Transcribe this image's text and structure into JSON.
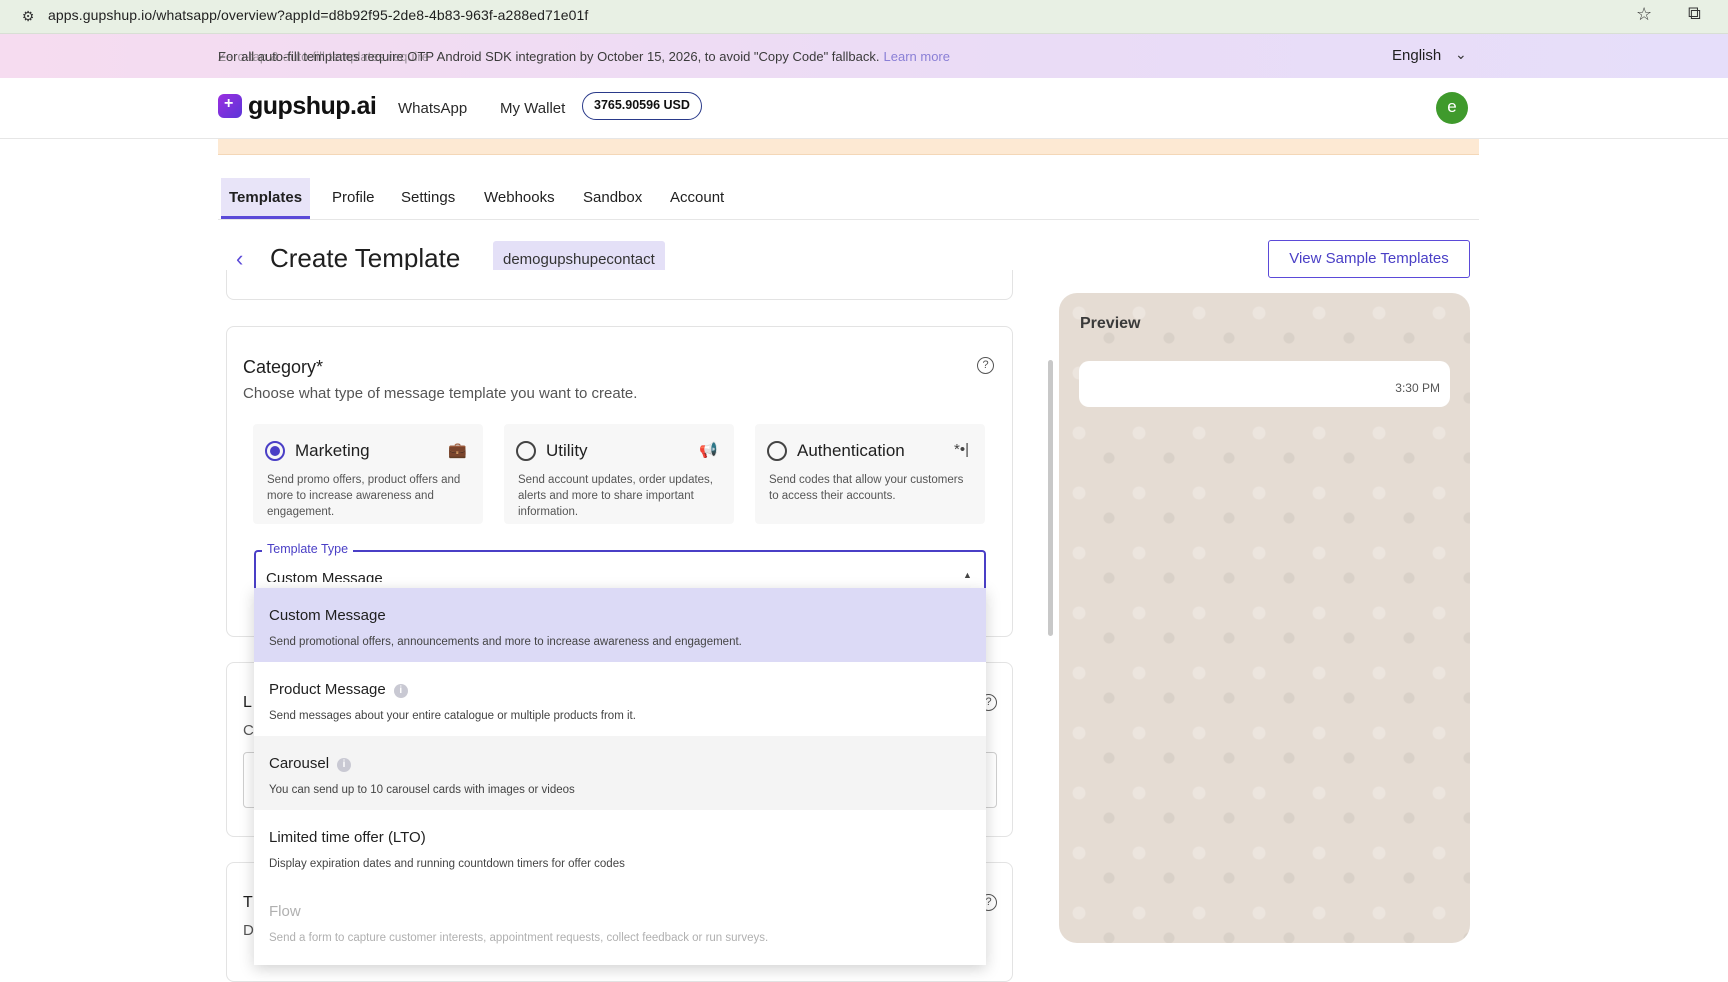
{
  "browser": {
    "url": "apps.gupshup.io/whatsapp/overview?appId=d8b92f95-2de8-4b83-963f-a288ed71e01f"
  },
  "banner": {
    "text": "For all auto-fill templates require OTP Android SDK integration by October 15, 2026, to avoid \"Copy Code\" fallback.",
    "overlay_text": "Zero-tap & auto-fill templates require",
    "learn_more": "Learn more",
    "language": "English"
  },
  "header": {
    "logo": "gupshup.ai",
    "nav_whatsapp": "WhatsApp",
    "nav_wallet": "My Wallet",
    "wallet_balance": "3765.90596 USD",
    "avatar_initial": "e"
  },
  "tabs": [
    {
      "label": "Templates",
      "active": true
    },
    {
      "label": "Profile"
    },
    {
      "label": "Settings"
    },
    {
      "label": "Webhooks"
    },
    {
      "label": "Sandbox"
    },
    {
      "label": "Account"
    }
  ],
  "title_row": {
    "title": "Create Template",
    "app_name": "demogupshupecontact",
    "sample_button": "View Sample Templates"
  },
  "category": {
    "title": "Category*",
    "subtitle": "Choose what type of message template you want to create.",
    "options": [
      {
        "label": "Marketing",
        "desc": "Send promo offers, product offers and more to increase awareness and engagement.",
        "icon": "briefcase-icon",
        "selected": true
      },
      {
        "label": "Utility",
        "desc": "Send account updates, order updates, alerts and more to share important information.",
        "icon": "megaphone-icon",
        "selected": false
      },
      {
        "label": "Authentication",
        "desc": "Send codes that allow your customers to access their accounts.",
        "icon": "password-icon",
        "selected": false
      }
    ],
    "template_type_label": "Template Type",
    "template_type_value": "Custom Message"
  },
  "dropdown": {
    "items": [
      {
        "title": "Custom Message",
        "desc": "Send promotional offers, announcements and more to increase awareness and engagement."
      },
      {
        "title": "Product Message",
        "desc": "Send messages about your entire catalogue or multiple products from it."
      },
      {
        "title": "Carousel",
        "desc": "You can send up to 10 carousel cards with images or videos"
      },
      {
        "title": "Limited time offer (LTO)",
        "desc": "Display expiration dates and running countdown timers for offer codes"
      },
      {
        "title": "Flow",
        "desc": "Send a form to capture customer interests, appointment requests, collect feedback or run surveys."
      }
    ]
  },
  "partial": {
    "l1": "L",
    "c1": "C",
    "t1": "T",
    "d1": "D"
  },
  "preview": {
    "title": "Preview",
    "time": "3:30 PM"
  }
}
